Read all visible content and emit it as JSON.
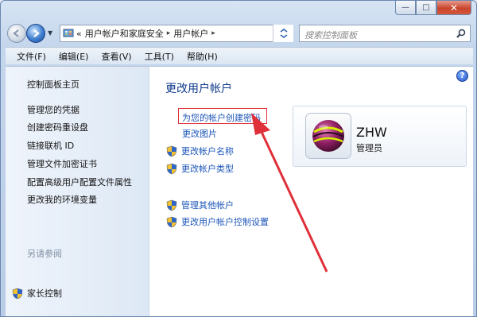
{
  "window": {
    "caption_buttons": {
      "minimize": "—",
      "maximize": "□",
      "close": "✕"
    }
  },
  "navbar": {
    "breadcrumb": [
      "«",
      "用户帐户和家庭安全",
      "用户帐户"
    ],
    "search_placeholder": "搜索控制面板"
  },
  "menu": [
    "文件(F)",
    "编辑(E)",
    "查看(V)",
    "工具(T)",
    "帮助(H)"
  ],
  "sidebar": {
    "items": [
      "控制面板主页",
      "管理您的凭据",
      "创建密码重设盘",
      "链接联机 ID",
      "管理文件加密证书",
      "配置高级用户配置文件属性",
      "更改我的环境变量"
    ],
    "see_also_title": "另请参阅",
    "see_also_items": [
      "家长控制"
    ]
  },
  "main": {
    "title": "更改用户帐户",
    "links_primary": [
      "为您的帐户创建密码",
      "更改图片",
      "更改帐户名称",
      "更改帐户类型"
    ],
    "links_secondary": [
      "管理其他帐户",
      "更改用户帐户控制设置"
    ]
  },
  "user": {
    "name": "ZHW",
    "role": "管理员"
  },
  "colors": {
    "highlight": "#e0303a",
    "link": "#1d56b8",
    "title": "#0f3a8c"
  },
  "icons": {
    "shield": "uac-shield-icon",
    "help": "?"
  }
}
